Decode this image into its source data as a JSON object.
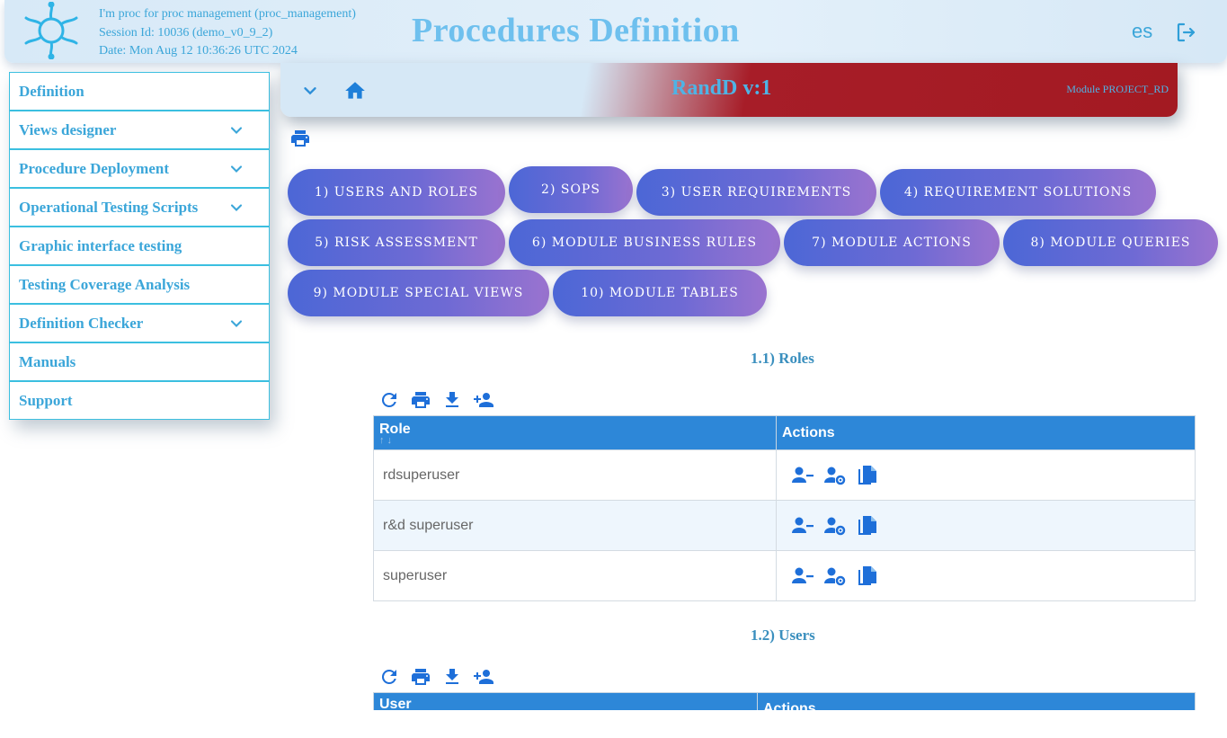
{
  "header": {
    "session_lines": [
      "I'm proc for proc management (proc_management)",
      "Session Id: 10036 (demo_v0_9_2)",
      "Date: Mon Aug 12 10:36:26 UTC 2024"
    ],
    "title": "Procedures Definition",
    "language": "es",
    "icons": {
      "logo": "molecule-logo-icon",
      "logout": "logout-icon"
    }
  },
  "sidebar": {
    "items": [
      {
        "label": "Definition",
        "expandable": false
      },
      {
        "label": "Views designer",
        "expandable": true
      },
      {
        "label": "Procedure Deployment",
        "expandable": true
      },
      {
        "label": "Operational Testing Scripts",
        "expandable": true
      },
      {
        "label": "Graphic interface testing",
        "expandable": false
      },
      {
        "label": "Testing Coverage Analysis",
        "expandable": false
      },
      {
        "label": "Definition Checker",
        "expandable": true
      },
      {
        "label": "Manuals",
        "expandable": false
      },
      {
        "label": "Support",
        "expandable": false
      }
    ]
  },
  "module_bar": {
    "title": "RandD v:1",
    "module": "Module PROJECT_RD",
    "icons": [
      "chevron-down-icon",
      "home-icon"
    ]
  },
  "tabs": [
    "1) Users and Roles",
    "2) SOPs",
    "3) User Requirements",
    "4) Requirement Solutions",
    "5) Risk Assessment",
    "6) Module Business Rules",
    "7) Module Actions",
    "8) Module Queries",
    "9) Module Special Views",
    "10) Module Tables"
  ],
  "roles_section": {
    "title": "1.1) Roles",
    "toolbar": [
      "refresh-icon",
      "print-icon",
      "download-icon",
      "add-person-icon"
    ],
    "columns": [
      "Role",
      "Actions"
    ],
    "rows": [
      "rdsuperuser",
      "r&d superuser",
      "superuser"
    ],
    "row_actions": [
      "remove-person-icon",
      "person-settings-icon",
      "copy-icon"
    ]
  },
  "users_section": {
    "title": "1.2) Users",
    "toolbar": [
      "refresh-icon",
      "print-icon",
      "download-icon",
      "add-person-icon"
    ],
    "columns": [
      "User",
      "Actions"
    ]
  },
  "colors": {
    "accent": "#3ba6d9",
    "table_header": "#2d87d8",
    "icon_blue": "#1e6fd9",
    "module_bar_red": "#a31a22"
  }
}
